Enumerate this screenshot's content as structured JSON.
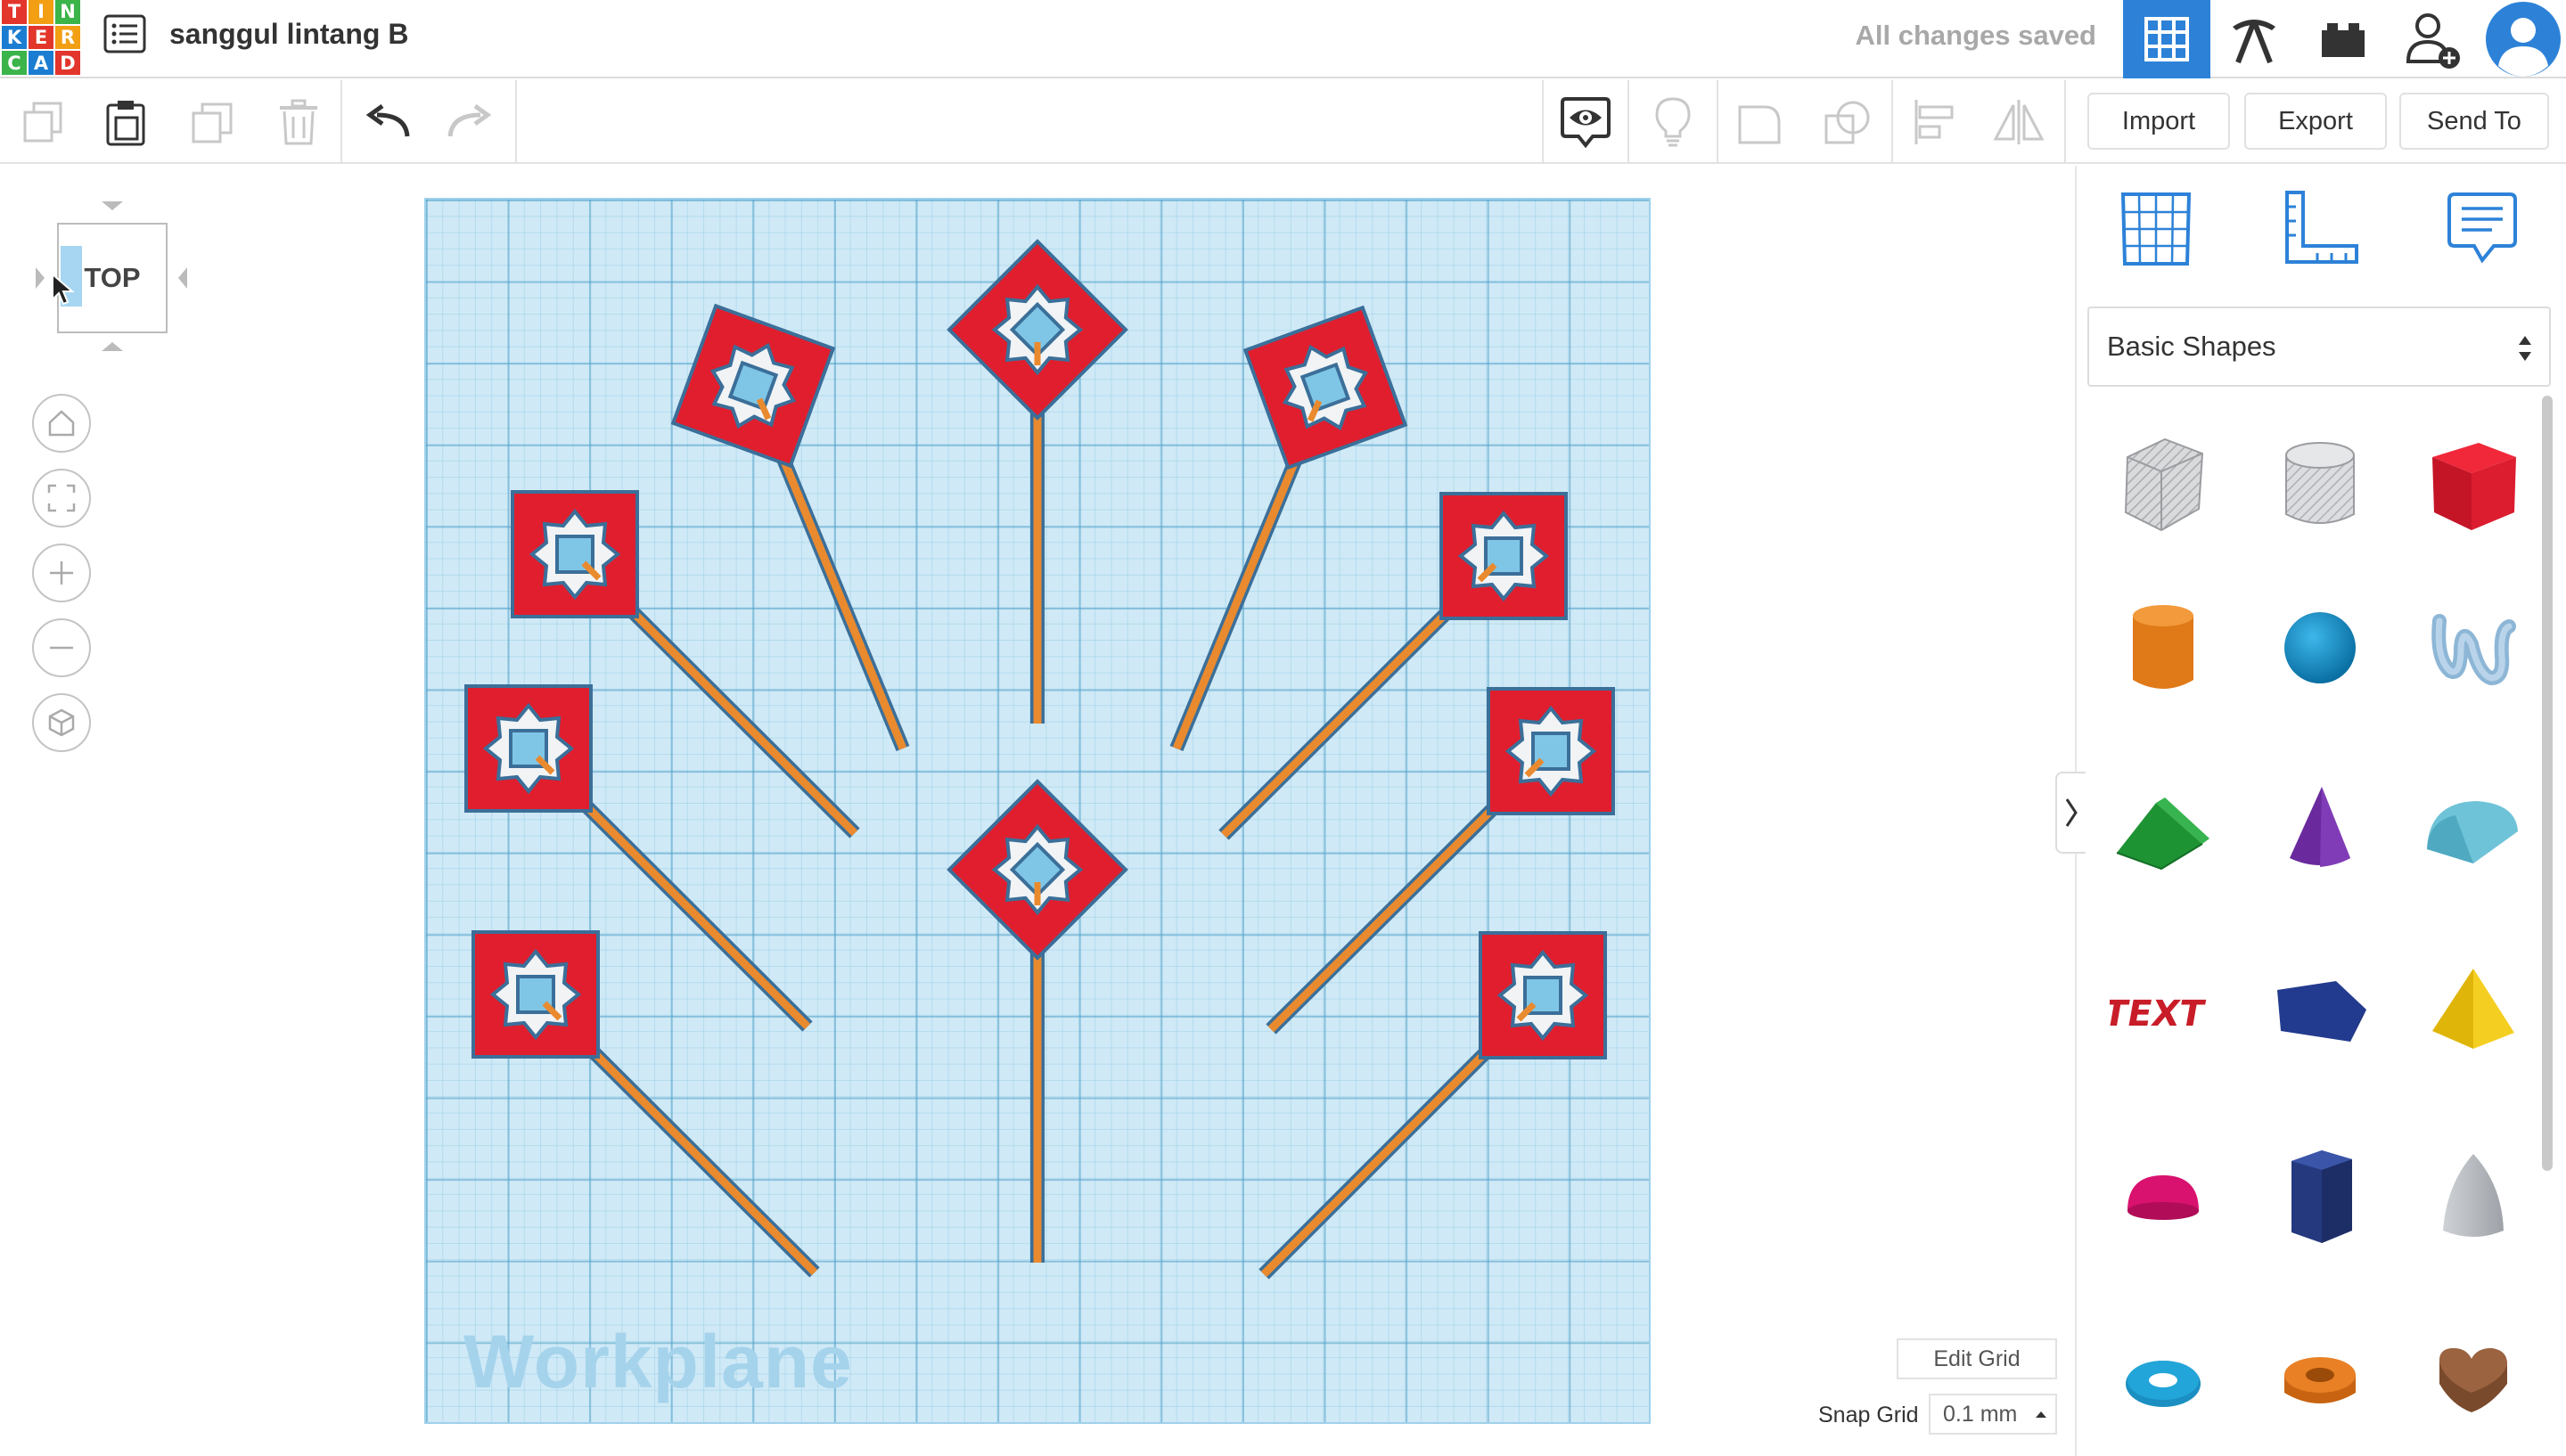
{
  "app": {
    "logo_letters": [
      "T",
      "I",
      "N",
      "K",
      "E",
      "R",
      "C",
      "A",
      "D"
    ],
    "project_title": "sanggul lintang B",
    "save_status": "All changes saved"
  },
  "header_buttons": [
    {
      "name": "3d-design-grid-icon",
      "active": true
    },
    {
      "name": "pickaxe-icon",
      "active": false
    },
    {
      "name": "bricks-icon",
      "active": false
    },
    {
      "name": "add-user-icon",
      "active": false
    },
    {
      "name": "avatar",
      "active": false
    }
  ],
  "toolbar": {
    "import_label": "Import",
    "export_label": "Export",
    "send_to_label": "Send To"
  },
  "view": {
    "cube_face": "TOP"
  },
  "workplane": {
    "label": "Workplane",
    "edit_grid_label": "Edit Grid",
    "snap_grid_label": "Snap Grid",
    "snap_grid_value": "0.1 mm"
  },
  "shapes_panel": {
    "category": "Basic Shapes",
    "shapes": [
      "box-hole-icon",
      "cylinder-hole-icon",
      "box-icon",
      "cylinder-icon",
      "sphere-icon",
      "scribble-icon",
      "roof-icon",
      "cone-icon",
      "round-roof-icon",
      "text-icon",
      "polygon-icon",
      "pyramid-icon",
      "half-sphere-icon",
      "hexagonal-prism-icon",
      "paraboloid-icon",
      "torus-icon",
      "tube-icon",
      "heart-icon"
    ],
    "text_shape_label": "TEXT"
  },
  "colors": {
    "accent": "#2d82d8",
    "flag_red": "#e01e2e",
    "stick_orange": "#e98a2f",
    "outline_blue": "#3b6f99",
    "workplane_bg": "#cfe9f6"
  }
}
